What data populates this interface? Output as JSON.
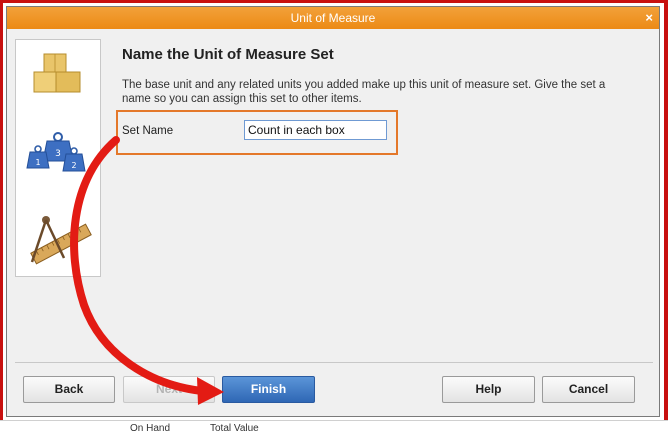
{
  "window": {
    "title": "Unit of Measure",
    "close_glyph": "×"
  },
  "page": {
    "heading": "Name the Unit of Measure Set",
    "description": "The base unit and any related units you added make up this unit of measure set. Give the set a name so you can assign this set to other items.",
    "set_name_label": "Set Name",
    "set_name_value": "Count in each box"
  },
  "side_icons": [
    "boxes-icon",
    "weights-icon",
    "ruler-compass-icon"
  ],
  "weights": {
    "a": "1",
    "b": "3",
    "c": "2"
  },
  "buttons": {
    "back": "Back",
    "next": "Next",
    "finish": "Finish",
    "help": "Help",
    "cancel": "Cancel"
  },
  "background_text": [
    "On Hand",
    "Total Value"
  ],
  "colors": {
    "title_orange": "#ec8a15",
    "frame_red": "#c8100f",
    "highlight_orange": "#e4782a",
    "arrow_red": "#e31b14",
    "primary_blue": "#2f67b5"
  }
}
